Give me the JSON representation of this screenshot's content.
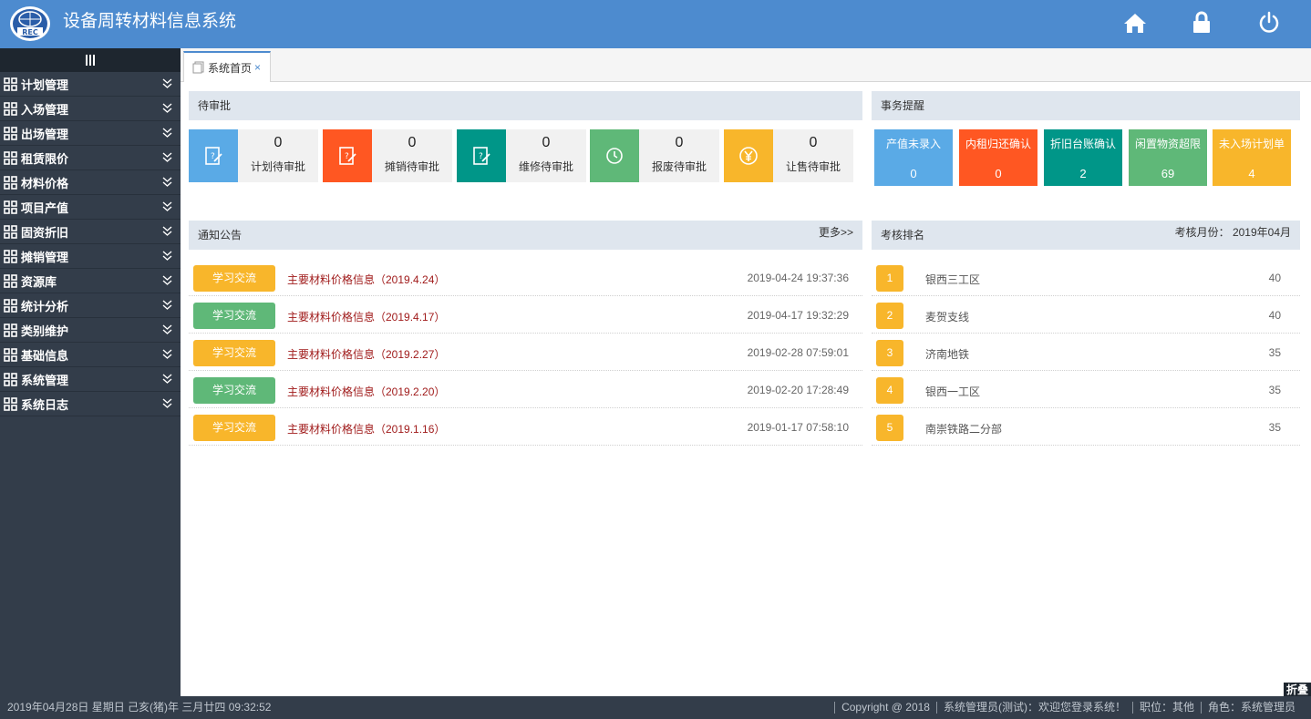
{
  "header": {
    "title": "设备周转材料信息系统",
    "logo_text": "REC",
    "icons": [
      "home-icon",
      "lock-icon",
      "power-icon"
    ]
  },
  "sidebar": {
    "items": [
      {
        "label": "计划管理"
      },
      {
        "label": "入场管理"
      },
      {
        "label": "出场管理"
      },
      {
        "label": "租赁限价"
      },
      {
        "label": "材料价格"
      },
      {
        "label": "项目产值"
      },
      {
        "label": "固资折旧"
      },
      {
        "label": "摊销管理"
      },
      {
        "label": "资源库"
      },
      {
        "label": "统计分析"
      },
      {
        "label": "类别维护"
      },
      {
        "label": "基础信息"
      },
      {
        "label": "系统管理"
      },
      {
        "label": "系统日志"
      }
    ]
  },
  "tabs": [
    {
      "label": "系统首页",
      "close": "×"
    }
  ],
  "pending": {
    "title": "待审批",
    "cards": [
      {
        "count": "0",
        "label": "计划待审批",
        "color": "#5aaae6"
      },
      {
        "count": "0",
        "label": "摊销待审批",
        "color": "#ff5722"
      },
      {
        "count": "0",
        "label": "维修待审批",
        "color": "#009688"
      },
      {
        "count": "0",
        "label": "报废待审批",
        "color": "#5fb878"
      },
      {
        "count": "0",
        "label": "让售待审批",
        "color": "#f8b62b"
      }
    ]
  },
  "reminders": {
    "title": "事务提醒",
    "cards": [
      {
        "label": "产值未录入",
        "count": "0",
        "color": "#5aaae6"
      },
      {
        "label": "内租归还确认",
        "count": "0",
        "color": "#ff5722"
      },
      {
        "label": "折旧台账确认",
        "count": "2",
        "color": "#009688"
      },
      {
        "label": "闲置物资超限",
        "count": "69",
        "color": "#5fb878"
      },
      {
        "label": "未入场计划单",
        "count": "4",
        "color": "#f8b62b"
      }
    ]
  },
  "notices": {
    "title": "通知公告",
    "more": "更多>>",
    "items": [
      {
        "tag": "学习交流",
        "tag_color": "#f8b62b",
        "title": "主要材料价格信息（2019.4.24）",
        "date": "2019-04-24 19:37:36"
      },
      {
        "tag": "学习交流",
        "tag_color": "#5fb878",
        "title": "主要材料价格信息（2019.4.17）",
        "date": "2019-04-17 19:32:29"
      },
      {
        "tag": "学习交流",
        "tag_color": "#f8b62b",
        "title": "主要材料价格信息（2019.2.27）",
        "date": "2019-02-28 07:59:01"
      },
      {
        "tag": "学习交流",
        "tag_color": "#5fb878",
        "title": "主要材料价格信息（2019.2.20）",
        "date": "2019-02-20 17:28:49"
      },
      {
        "tag": "学习交流",
        "tag_color": "#f8b62b",
        "title": "主要材料价格信息（2019.1.16）",
        "date": "2019-01-17 07:58:10"
      }
    ]
  },
  "ranking": {
    "title": "考核排名",
    "month_label": "考核月份：",
    "month_value": "2019年04月",
    "items": [
      {
        "rank": "1",
        "name": "银西三工区",
        "score": "40"
      },
      {
        "rank": "2",
        "name": "麦贺支线",
        "score": "40"
      },
      {
        "rank": "3",
        "name": "济南地铁",
        "score": "35"
      },
      {
        "rank": "4",
        "name": "银西一工区",
        "score": "35"
      },
      {
        "rank": "5",
        "name": "南崇铁路二分部",
        "score": "35"
      }
    ]
  },
  "footer": {
    "datetime": "2019年04月28日 星期日 己亥(猪)年 三月廿四 09:32:52",
    "copyright": "Copyright @ 2018",
    "welcome": "系统管理员(测试)：欢迎您登录系统！",
    "position": "职位：其他",
    "role": "角色：系统管理员",
    "fold": "折叠"
  }
}
